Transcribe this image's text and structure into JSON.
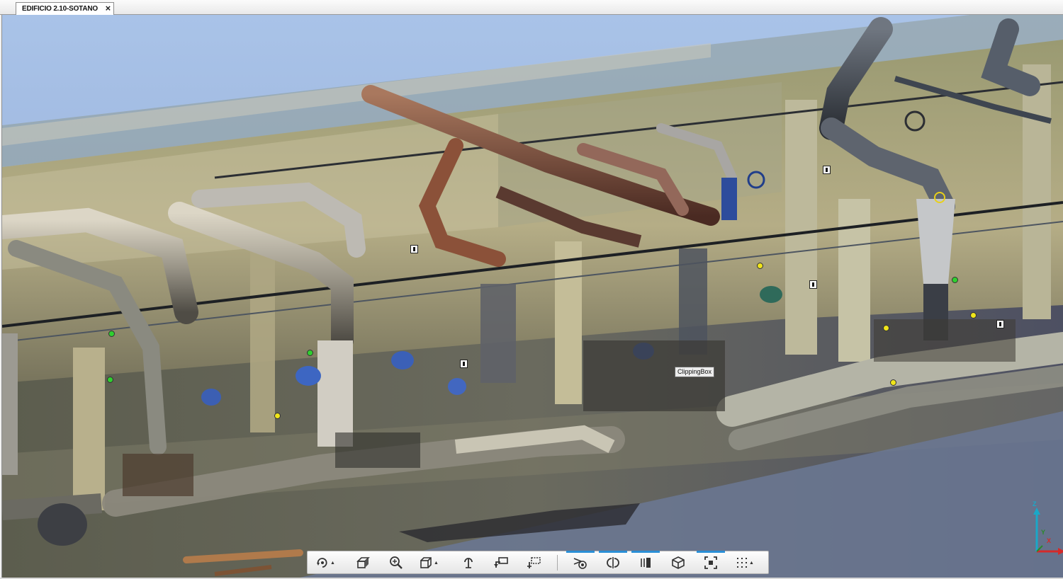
{
  "window": {
    "tab_title": "EDIFICIO 2.10-SOTANO",
    "tab_close": "×"
  },
  "viewport": {
    "scene_description_icon": "point-cloud-scene",
    "clipping_box_label": "ClippingBox",
    "axis": {
      "z": "Z",
      "x": "X",
      "y": "Y"
    },
    "colors": {
      "background_top": "#a9c3e8",
      "background_bottom": "#7b8eab",
      "axis_z": "#1aa8c8",
      "axis_x": "#d42a2a",
      "axis_y": "#2a8a2a",
      "marker_yellow": "#f0e51a",
      "marker_green": "#2fd02f"
    }
  },
  "toolbar": {
    "buttons": [
      {
        "icon": "orbit-icon",
        "has_menu": true,
        "active": false
      },
      {
        "icon": "camera-view-icon",
        "has_menu": false,
        "active": false
      },
      {
        "icon": "zoom-icon",
        "has_menu": false,
        "active": false
      },
      {
        "icon": "view-cube-icon",
        "has_menu": true,
        "active": false
      },
      {
        "icon": "walk-icon",
        "has_menu": false,
        "active": false
      },
      {
        "icon": "fly-icon",
        "has_menu": false,
        "active": false
      },
      {
        "icon": "measure-icon",
        "has_menu": false,
        "active": false
      },
      {
        "icon": "section-select-icon",
        "has_menu": false,
        "active": true
      },
      {
        "icon": "section-mirror-icon",
        "has_menu": false,
        "active": true
      },
      {
        "icon": "section-slice-icon",
        "has_menu": false,
        "active": true
      },
      {
        "icon": "clipping-box-icon",
        "has_menu": false,
        "active": false
      },
      {
        "icon": "fit-extents-icon",
        "has_menu": false,
        "active": true
      },
      {
        "icon": "more-options-icon",
        "has_menu": true,
        "active": false
      }
    ],
    "menu_caret": "▲"
  }
}
